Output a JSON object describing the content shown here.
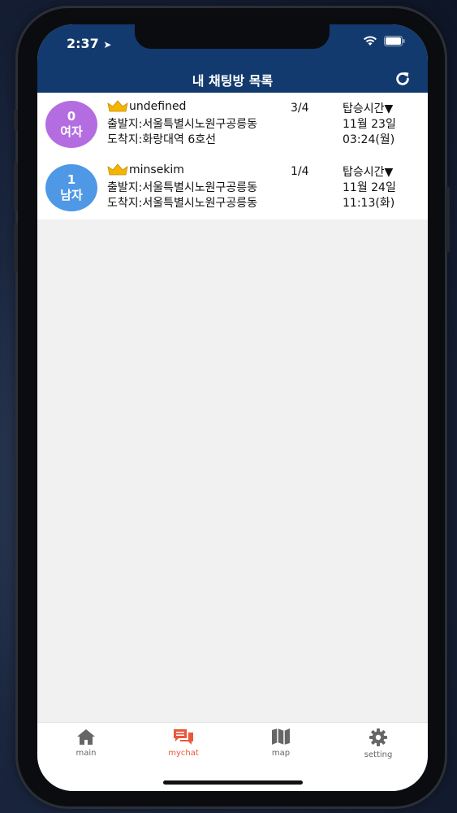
{
  "status": {
    "time": "2:37"
  },
  "header": {
    "title": "내 채팅방 목록"
  },
  "rooms": [
    {
      "avatar_count": "0",
      "avatar_gender": "여자",
      "avatar_color": "#b46de0",
      "owner": "undefined",
      "departure": "출발지:서울특별시노원구공릉동",
      "destination": "도착지:화랑대역 6호선",
      "occupancy": "3/4",
      "time_label": "탑승시간▼",
      "date": "11월 23일",
      "time": "03:24(월)"
    },
    {
      "avatar_count": "1",
      "avatar_gender": "남자",
      "avatar_color": "#4e98e6",
      "owner": "minsekim",
      "departure": "출발지:서울특별시노원구공릉동",
      "destination": "도착지:서울특별시노원구공릉동",
      "occupancy": "1/4",
      "time_label": "탑승시간▼",
      "date": "11월 24일",
      "time": "11:13(화)"
    }
  ],
  "tabs": [
    {
      "label": "main",
      "icon": "home-icon"
    },
    {
      "label": "mychat",
      "icon": "chat-icon",
      "active": true
    },
    {
      "label": "map",
      "icon": "map-icon"
    },
    {
      "label": "setting",
      "icon": "gear-icon"
    }
  ],
  "colors": {
    "header": "#123a6e",
    "active_tab": "#e8583a",
    "inactive_tab": "#666666",
    "crown": "#f4b400"
  }
}
